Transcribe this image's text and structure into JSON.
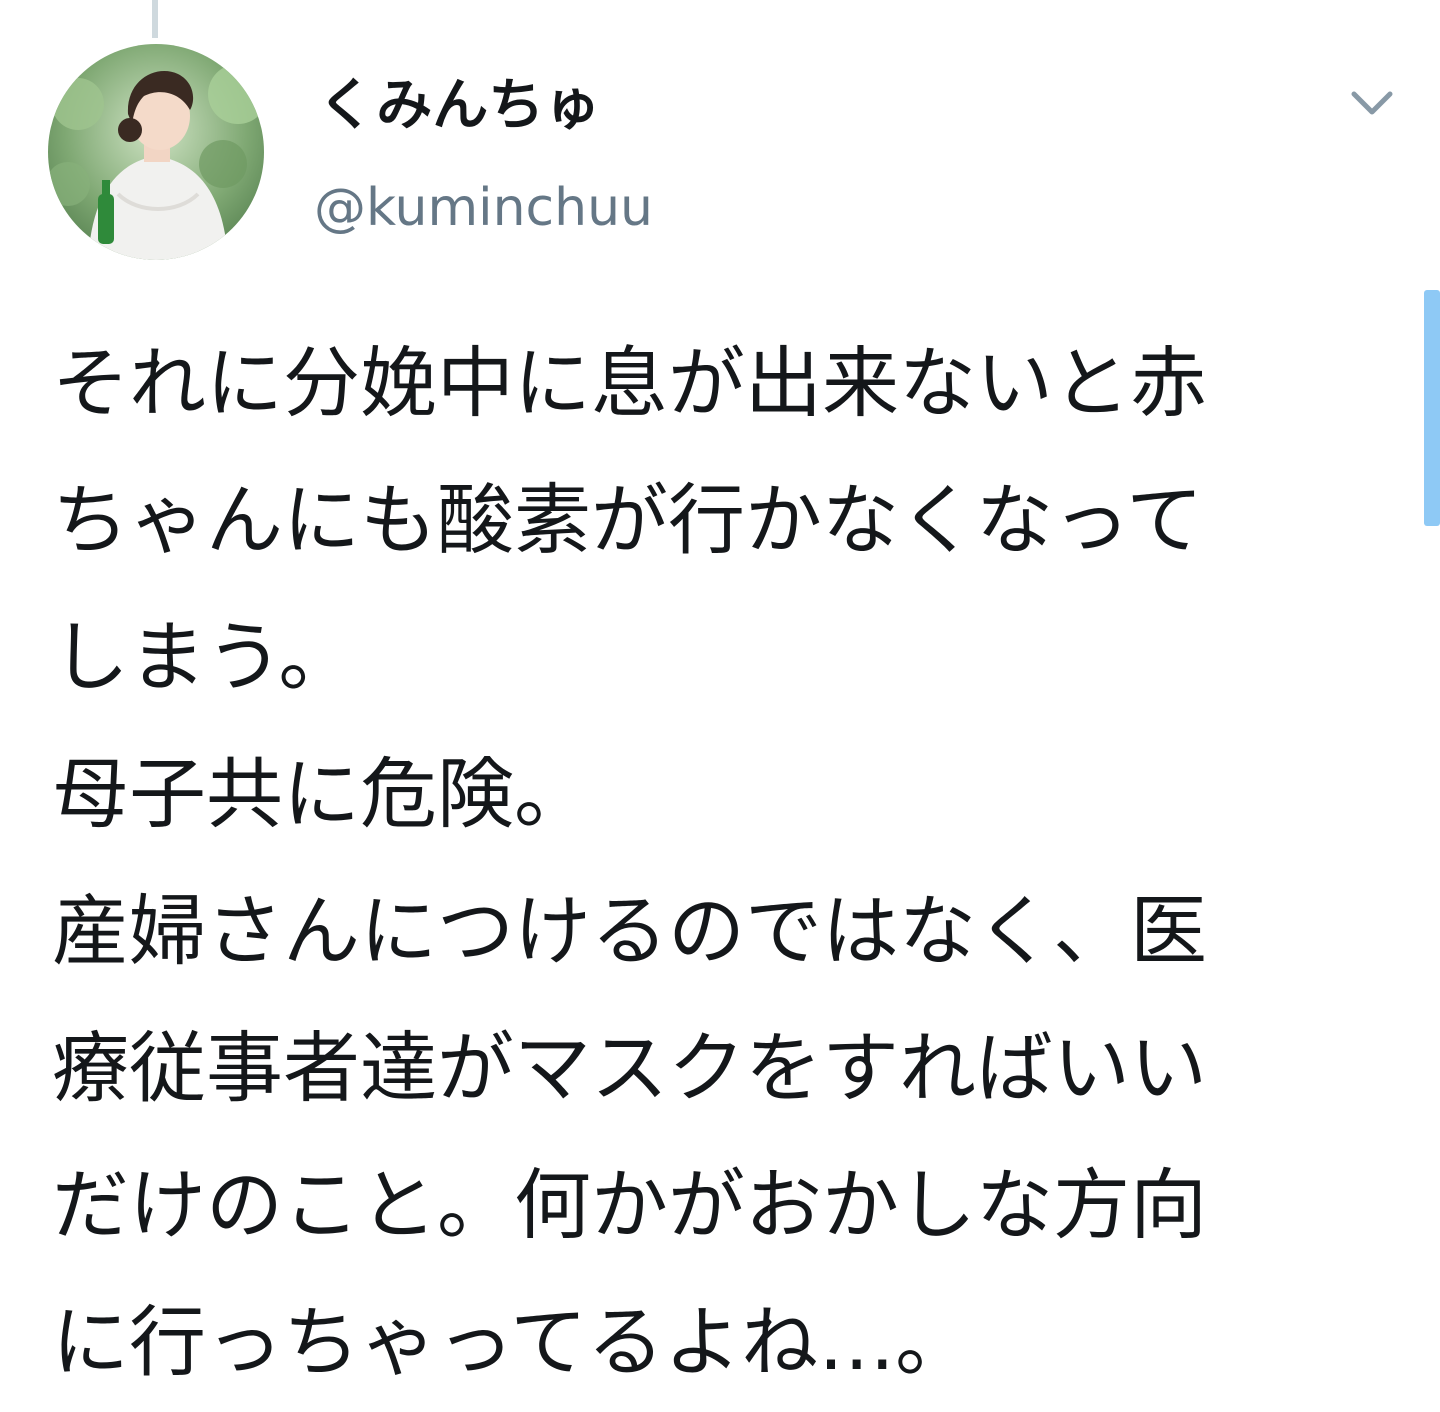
{
  "thread": {
    "connector_color": "#cfd9de"
  },
  "author": {
    "display_name": "くみんちゅ",
    "handle": "@kuminchuu",
    "avatar_icon": "profile-photo-icon"
  },
  "menu": {
    "icon": "chevron-down-icon"
  },
  "tweet": {
    "lines": [
      "それに分娩中に息が出来ないと赤",
      "ちゃんにも酸素が行かなくなって",
      "しまう。",
      "母子共に危険。",
      "産婦さんにつけるのではなく、医",
      "療従事者達がマスクをすればいい",
      "だけのこと。何かがおかしな方向",
      "に行っちゃってるよね…。"
    ]
  },
  "colors": {
    "text_primary": "#14171a",
    "text_secondary": "#657786",
    "scroll_accent": "#8ec9f5"
  }
}
